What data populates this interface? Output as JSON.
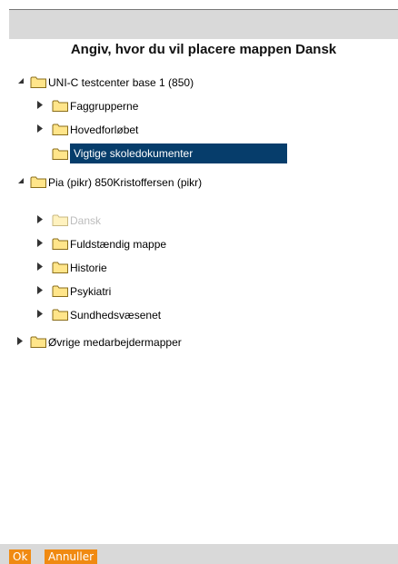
{
  "dialog": {
    "title": "Angiv, hvor du vil placere mappen Dansk"
  },
  "tree": {
    "nodes": [
      {
        "label": "UNI-C testcenter base 1 (850)",
        "state": "expanded"
      },
      {
        "label": "Faggrupperne",
        "state": "collapsed"
      },
      {
        "label": "Hovedforløbet",
        "state": "collapsed"
      },
      {
        "label": "Vigtige skoledokumenter",
        "state": "leaf",
        "selected": true
      },
      {
        "label": "Pia (pikr) 850Kristoffersen (pikr)",
        "state": "expanded"
      },
      {
        "label": "Dansk",
        "state": "collapsed",
        "disabled": true
      },
      {
        "label": "Fuldstændig mappe",
        "state": "collapsed"
      },
      {
        "label": "Historie",
        "state": "collapsed"
      },
      {
        "label": "Psykiatri",
        "state": "collapsed"
      },
      {
        "label": "Sundhedsvæsenet",
        "state": "collapsed"
      },
      {
        "label": "Øvrige medarbejdermapper",
        "state": "collapsed"
      }
    ]
  },
  "footer": {
    "ok_label": "Ok",
    "cancel_label": "Annuller"
  },
  "colors": {
    "selection": "#063d6b",
    "button": "#f08a12",
    "folder_fill": "#ffe58a",
    "folder_stroke": "#8a6d1a"
  },
  "icons": {
    "folder": "folder-icon",
    "expanded": "triangle-down-icon",
    "collapsed": "triangle-right-icon"
  }
}
